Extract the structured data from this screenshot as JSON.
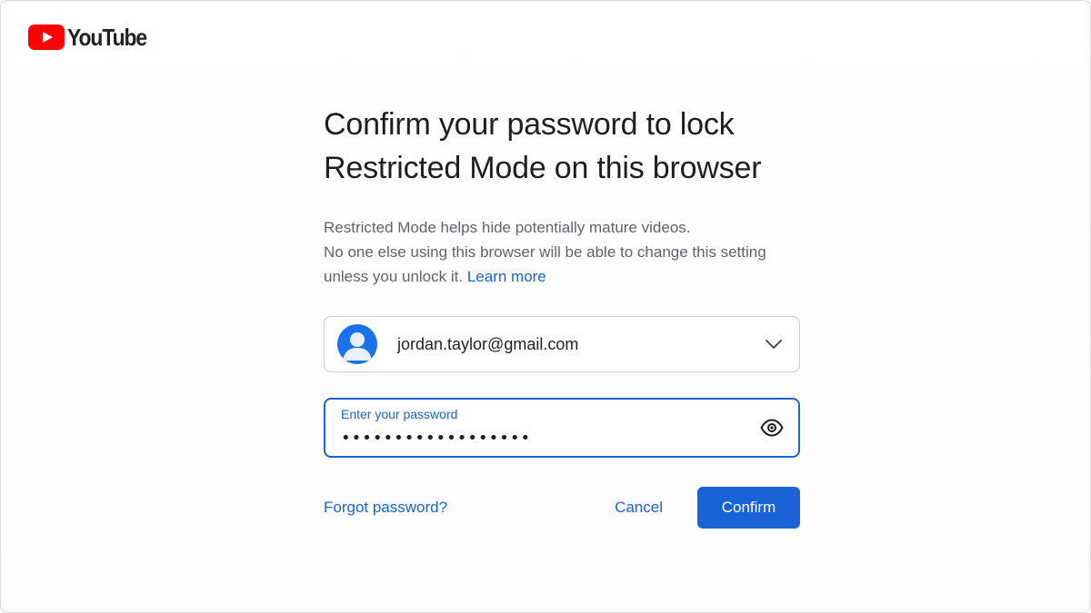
{
  "brand": {
    "name": "YouTube",
    "logo_icon": "youtube-play-icon",
    "logo_color": "#ff0000"
  },
  "dialog": {
    "title_line1": "Confirm your password to lock",
    "title_line2": "Restricted Mode on this browser",
    "desc_line1": "Restricted Mode helps hide potentially mature videos.",
    "desc_line2": "No one else using this browser will be able to change this setting",
    "desc_line3": "unless you unlock it.",
    "learn_more": "Learn more"
  },
  "account": {
    "email": "jordan.taylor@gmail.com",
    "avatar_icon": "person-avatar-icon",
    "dropdown_icon": "chevron-down-icon"
  },
  "password": {
    "label": "Enter your password",
    "value": "••••••••••••••••••",
    "toggle_icon": "eye-icon"
  },
  "actions": {
    "forgot": "Forgot password?",
    "cancel": "Cancel",
    "confirm": "Confirm"
  },
  "colors": {
    "accent": "#1a63d6",
    "title": "#1f1f1f",
    "body": "#5f6368",
    "border": "#c9ccd1"
  }
}
